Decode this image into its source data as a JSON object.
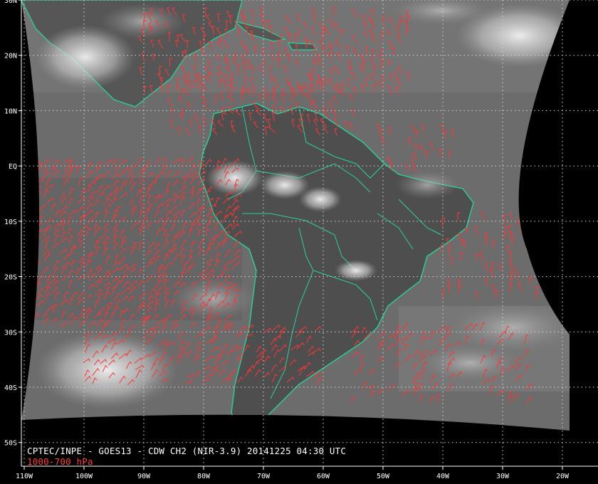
{
  "caption": {
    "title": "CPTEC/INPE - GOES13 - CDW CH2 (NIR-3.9) 20141225 04:30 UTC",
    "level": "1000-700 hPa"
  },
  "axes": {
    "lat_ticks": [
      "30N",
      "20N",
      "10N",
      "EQ",
      "10S",
      "20S",
      "30S",
      "40S",
      "50S"
    ],
    "lat_values": [
      30,
      20,
      10,
      0,
      -10,
      -20,
      -30,
      -40,
      -50
    ],
    "lon_ticks": [
      "110W",
      "100W",
      "90W",
      "80W",
      "70W",
      "60W",
      "50W",
      "40W",
      "30W",
      "20W"
    ],
    "lon_values": [
      -110,
      -100,
      -90,
      -80,
      -70,
      -60,
      -50,
      -40,
      -30,
      -20
    ]
  },
  "map": {
    "lat_range": [
      -57.5,
      30
    ],
    "lon_range": [
      -110,
      -10
    ],
    "grid_style": "dotted",
    "grid_color": "#d8d8d8",
    "coast_color": "#27d39a",
    "wind_color": "#ff3535",
    "background_color": "#000000",
    "ocean_gray": "#6e6e6e",
    "land_gray": "#4c4c4c"
  },
  "wind_regions": [
    {
      "lon": [
        -90,
        -45
      ],
      "lat": [
        12,
        27
      ],
      "density": 0.55,
      "dir": 250
    },
    {
      "lon": [
        -85,
        -55
      ],
      "lat": [
        5,
        15
      ],
      "density": 0.45,
      "dir": 240
    },
    {
      "lon": [
        -108,
        -75
      ],
      "lat": [
        -30,
        0
      ],
      "density": 0.8,
      "dir": 300
    },
    {
      "lon": [
        -100,
        -60
      ],
      "lat": [
        -40,
        -30
      ],
      "density": 0.55,
      "dir": 310
    },
    {
      "lon": [
        -55,
        -25
      ],
      "lat": [
        -43,
        -30
      ],
      "density": 0.4,
      "dir": 300
    },
    {
      "lon": [
        -40,
        -22
      ],
      "lat": [
        -25,
        -10
      ],
      "density": 0.35,
      "dir": 260
    },
    {
      "lon": [
        -50,
        -38
      ],
      "lat": [
        -2,
        6
      ],
      "density": 0.35,
      "dir": 250
    }
  ]
}
